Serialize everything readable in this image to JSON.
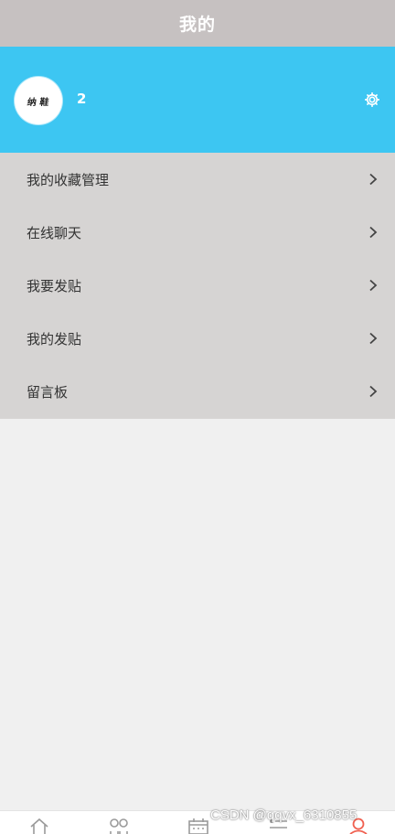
{
  "header": {
    "title": "我的"
  },
  "profile": {
    "avatar_text": "纳 鞋",
    "username": "2",
    "settings_icon": "gear-icon",
    "background": "#3dc6f2"
  },
  "menu": {
    "items": [
      {
        "label": "我的收藏管理",
        "icon": "chevron-right-icon"
      },
      {
        "label": "在线聊天",
        "icon": "chevron-right-icon"
      },
      {
        "label": "我要发贴",
        "icon": "chevron-right-icon"
      },
      {
        "label": "我的发贴",
        "icon": "chevron-right-icon"
      },
      {
        "label": "留言板",
        "icon": "chevron-right-icon"
      }
    ]
  },
  "bottom_nav": {
    "items": [
      {
        "icon": "home-icon"
      },
      {
        "icon": "category-icon"
      },
      {
        "icon": "calendar-icon"
      },
      {
        "icon": "list-icon"
      },
      {
        "icon": "user-icon",
        "active": true,
        "active_color": "#f06050"
      }
    ]
  },
  "watermark": "CSDN @qqvx_6310855"
}
